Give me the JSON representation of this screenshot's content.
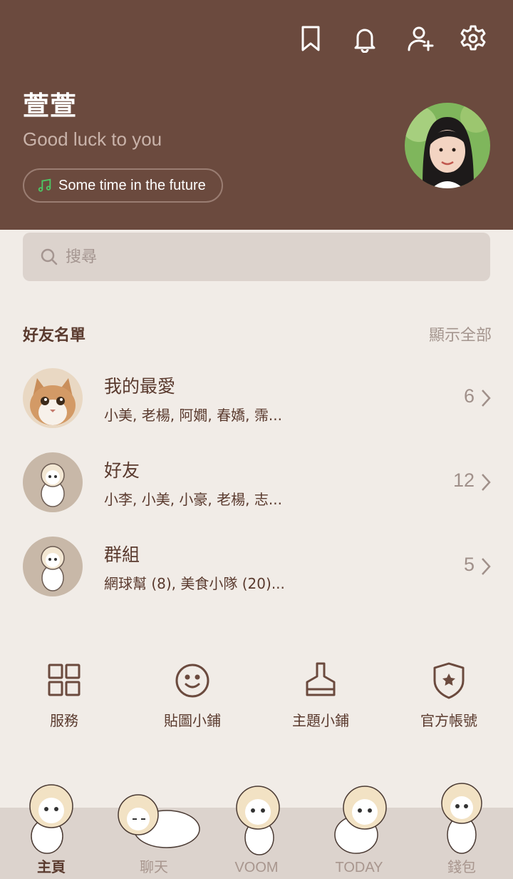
{
  "colors": {
    "header_bg": "#6b4a3e",
    "page_bg": "#f1ece7",
    "accent_brown": "#5a3a2e",
    "music_green": "#4cc764"
  },
  "header": {
    "icons": [
      "bookmark-icon",
      "bell-icon",
      "add-friend-icon",
      "settings-icon"
    ],
    "name": "萱萱",
    "status": "Good luck to you",
    "music": "Some time in the future"
  },
  "search": {
    "placeholder": "搜尋"
  },
  "friends": {
    "title": "好友名單",
    "show_all": "顯示全部",
    "rows": [
      {
        "title": "我的最愛",
        "subtitle": "小美, 老楊, 阿嫺, 春嬌, 霈...",
        "count": "6"
      },
      {
        "title": "好友",
        "subtitle": "小李, 小美, 小豪, 老楊, 志...",
        "count": "12"
      },
      {
        "title": "群組",
        "subtitle": "網球幫 (8), 美食小隊 (20)...",
        "count": "5"
      }
    ]
  },
  "shortcuts": [
    {
      "label": "服務",
      "icon": "grid-icon"
    },
    {
      "label": "貼圖小鋪",
      "icon": "smiley-icon"
    },
    {
      "label": "主題小鋪",
      "icon": "brush-icon"
    },
    {
      "label": "官方帳號",
      "icon": "shield-star-icon"
    }
  ],
  "tabs": [
    {
      "label": "主頁",
      "active": true
    },
    {
      "label": "聊天",
      "active": false
    },
    {
      "label": "VOOM",
      "active": false
    },
    {
      "label": "TODAY",
      "active": false
    },
    {
      "label": "錢包",
      "active": false
    }
  ]
}
